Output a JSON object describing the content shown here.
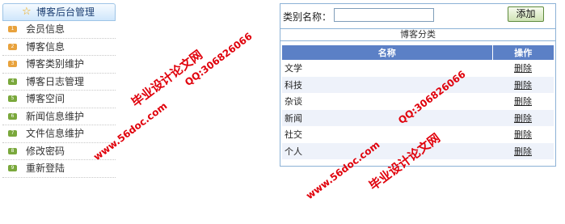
{
  "sidebar": {
    "title": "博客后台管理",
    "header_icon": "star-icon",
    "items": [
      {
        "num": "1",
        "label": "会员信息",
        "color": "#e8a23d"
      },
      {
        "num": "2",
        "label": "博客信息",
        "color": "#e8a23d"
      },
      {
        "num": "3",
        "label": "博客类别维护",
        "color": "#e8a23d"
      },
      {
        "num": "4",
        "label": "博客日志管理",
        "color": "#7aa83c"
      },
      {
        "num": "5",
        "label": "博客空间",
        "color": "#7aa83c"
      },
      {
        "num": "6",
        "label": "新闻信息维护",
        "color": "#7aa83c"
      },
      {
        "num": "7",
        "label": "文件信息维护",
        "color": "#7aa83c"
      },
      {
        "num": "8",
        "label": "修改密码",
        "color": "#7aa83c"
      },
      {
        "num": "9",
        "label": "重新登陆",
        "color": "#7aa83c"
      }
    ]
  },
  "form": {
    "label": "类别名称：",
    "input_value": "",
    "add_button": "添加"
  },
  "table": {
    "section_title": "博客分类",
    "headers": {
      "name": "名称",
      "op": "操作"
    },
    "rows": [
      {
        "name": "文学",
        "op": "删除"
      },
      {
        "name": "科技",
        "op": "删除"
      },
      {
        "name": "杂谈",
        "op": "删除"
      },
      {
        "name": "新闻",
        "op": "删除"
      },
      {
        "name": "社交",
        "op": "删除"
      },
      {
        "name": "个人",
        "op": "删除"
      }
    ]
  },
  "watermarks": {
    "w1": "毕业设计论文网",
    "w2": "QQ:306826066",
    "w3": "www.56doc.com",
    "w4": "QQ:306826066",
    "w5": "www.56doc.com",
    "w6": "毕业设计论文网"
  },
  "colors": {
    "header_blue": "#5b80c6",
    "border_blue": "#8db2d6",
    "watermark_red": "#e0000b"
  }
}
